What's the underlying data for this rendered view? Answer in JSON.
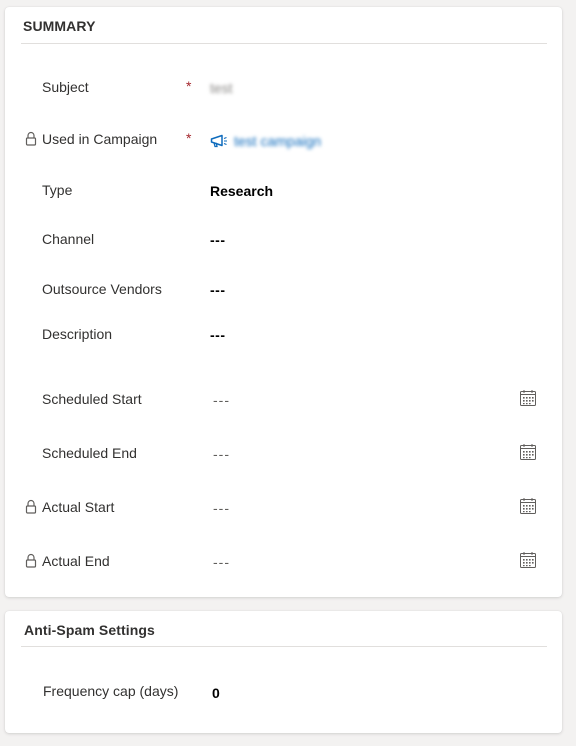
{
  "summary": {
    "title": "SUMMARY",
    "fields": {
      "subject": {
        "label": "Subject",
        "required": "*",
        "value": "test"
      },
      "campaign": {
        "label": "Used in Campaign",
        "required": "*",
        "value": "test campaign",
        "icon": "megaphone-icon"
      },
      "type": {
        "label": "Type",
        "value": "Research"
      },
      "channel": {
        "label": "Channel",
        "value": "---"
      },
      "vendors": {
        "label": "Outsource Vendors",
        "value": "---"
      },
      "description": {
        "label": "Description",
        "value": "---"
      },
      "scheduled_start": {
        "label": "Scheduled Start",
        "value": "---",
        "icon": "calendar-icon"
      },
      "scheduled_end": {
        "label": "Scheduled End",
        "value": "---",
        "icon": "calendar-icon"
      },
      "actual_start": {
        "label": "Actual Start",
        "value": "---",
        "icon": "calendar-icon"
      },
      "actual_end": {
        "label": "Actual End",
        "value": "---",
        "icon": "calendar-icon"
      }
    }
  },
  "antispam": {
    "title": "Anti-Spam Settings",
    "frequency_cap": {
      "label": "Frequency cap (days)",
      "value": "0"
    }
  },
  "colors": {
    "required": "#a4262c",
    "link": "#0f6cbd",
    "divider": "#e1dfdd",
    "background": "#f3f2f1"
  }
}
